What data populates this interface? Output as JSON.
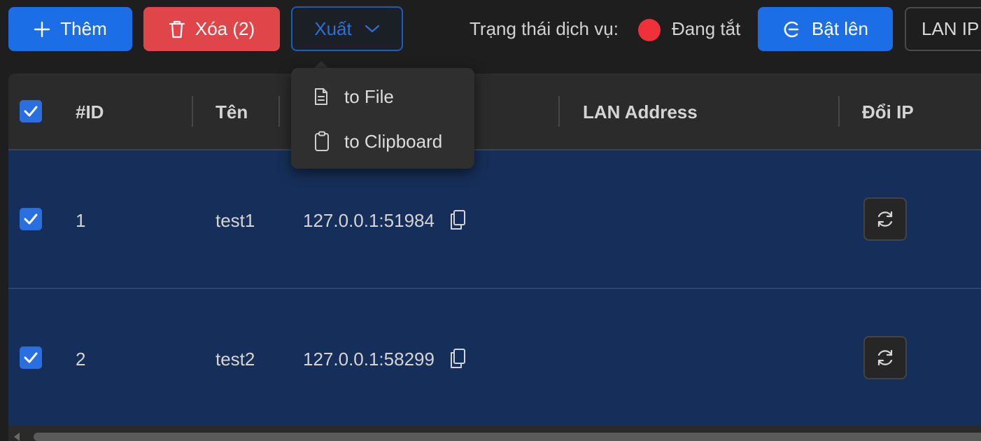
{
  "toolbar": {
    "add_label": "Thêm",
    "delete_label": "Xóa (2)",
    "export_label": "Xuất",
    "status_label": "Trạng thái dịch vụ:",
    "status_text": "Đang tắt",
    "status_color": "#f0313a",
    "enable_label": "Bật lên",
    "lan_ip_label": "LAN IP"
  },
  "export_menu": {
    "items": [
      {
        "label": "to File",
        "icon": "file-icon"
      },
      {
        "label": "to Clipboard",
        "icon": "clipboard-icon"
      }
    ]
  },
  "table": {
    "header_checked": true,
    "columns": [
      "#ID",
      "Tên",
      "",
      "LAN Address",
      "Đổi IP"
    ],
    "rows": [
      {
        "checked": true,
        "id": "1",
        "name": "test1",
        "address": "127.0.0.1:51984",
        "lan_address": ""
      },
      {
        "checked": true,
        "id": "2",
        "name": "test2",
        "address": "127.0.0.1:58299",
        "lan_address": ""
      }
    ]
  },
  "colors": {
    "primary": "#1c6ee6",
    "danger": "#df4549",
    "row_selected": "#162f5a",
    "header_bg": "#2b2b2b"
  }
}
